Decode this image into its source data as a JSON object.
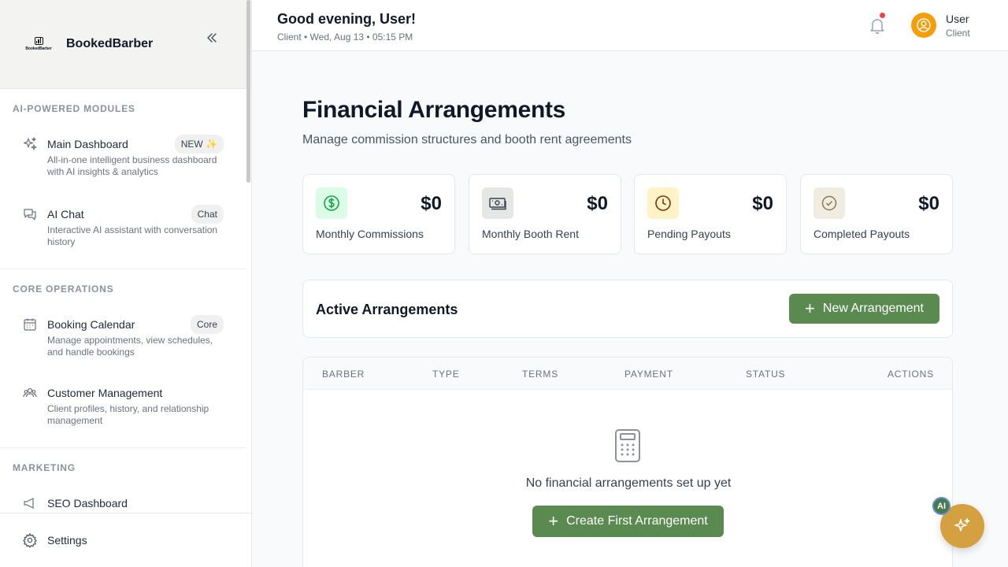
{
  "sidebar": {
    "brand": "BookedBarber",
    "logo_text": "BookedBarber",
    "sections": [
      {
        "label": "AI-POWERED MODULES",
        "items": [
          {
            "title": "Main Dashboard",
            "badge": "NEW ✨",
            "desc": "All-in-one intelligent business dashboard with AI insights & analytics",
            "icon": "sparkles-icon"
          },
          {
            "title": "AI Chat",
            "badge": "Chat",
            "desc": "Interactive AI assistant with conversation history",
            "icon": "chat-icon"
          }
        ]
      },
      {
        "label": "CORE OPERATIONS",
        "items": [
          {
            "title": "Booking Calendar",
            "badge": "Core",
            "desc": "Manage appointments, view schedules, and handle bookings",
            "icon": "calendar-icon"
          },
          {
            "title": "Customer Management",
            "badge": "",
            "desc": "Client profiles, history, and relationship management",
            "icon": "users-icon"
          }
        ]
      },
      {
        "label": "MARKETING",
        "items": [
          {
            "title": "SEO Dashboard",
            "badge": "",
            "desc": "",
            "icon": "megaphone-icon"
          }
        ]
      }
    ],
    "footer_label": "Settings"
  },
  "header": {
    "greeting": "Good evening, User!",
    "subtitle": "Client • Wed, Aug 13 • 05:15 PM",
    "user_name": "User",
    "user_role": "Client"
  },
  "main": {
    "title": "Financial Arrangements",
    "subtitle": "Manage commission structures and booth rent agreements",
    "stats": [
      {
        "value": "$0",
        "label": "Monthly Commissions",
        "icon": "dollar-icon",
        "color": "#dcfce7"
      },
      {
        "value": "$0",
        "label": "Monthly Booth Rent",
        "icon": "banknote-icon",
        "color": "#e5e7e5"
      },
      {
        "value": "$0",
        "label": "Pending Payouts",
        "icon": "clock-icon",
        "color": "#fef3c7"
      },
      {
        "value": "$0",
        "label": "Completed Payouts",
        "icon": "check-circle-icon",
        "color": "#f1ece0"
      }
    ],
    "panel_title": "Active Arrangements",
    "new_button": "New Arrangement",
    "table_headers": [
      "BARBER",
      "TYPE",
      "TERMS",
      "PAYMENT",
      "STATUS",
      "ACTIONS"
    ],
    "empty_text": "No financial arrangements set up yet",
    "create_button": "Create First Arrangement"
  },
  "fab": {
    "badge": "AI"
  },
  "colors": {
    "accent": "#5a8a4f",
    "fab": "#d4a040",
    "avatar": "#f59e0b",
    "notification": "#ef4444"
  }
}
